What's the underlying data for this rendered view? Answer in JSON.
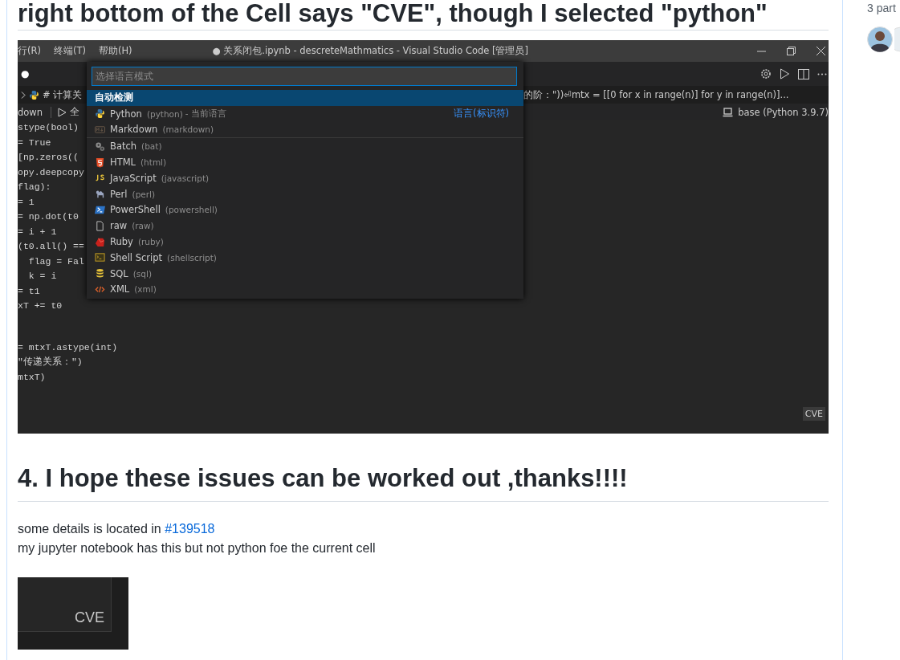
{
  "heading_top": "right bottom of the Cell says \"CVE\", though I selected \"python\"",
  "vscode_screenshot": {
    "menu": [
      "行(R)",
      "终端(T)",
      "帮助(H)"
    ],
    "title": "● 关系闭包.ipynb - descreteMathmatics - Visual Studio Code [管理员]",
    "tab_marker": "●",
    "breadcrumb_left": "# 计算关",
    "breadcrumb_right": "的阶：\"))⏎mtx = [[0 for x in range(n)] for y in range(n)]...",
    "toolbar": [
      "down",
      "全"
    ],
    "kernel": "base (Python 3.9.7)",
    "code_blocks": [
      [
        "stype(bool)",
        "= True",
        "[np.zeros((",
        "opy.deepcopy",
        "flag):",
        "= 1",
        "= np.dot(t0",
        "= i + 1",
        "(t0.all() ==",
        "  flag = Fal",
        "  k = i",
        "= t1",
        "xT += t0"
      ],
      [
        "= mtxT.astype(int)",
        "\"传递关系：\")",
        "mtxT)"
      ]
    ],
    "picker": {
      "placeholder": "选择语言模式",
      "items": [
        {
          "kind": "auto",
          "name": "自动检测",
          "selected": true
        },
        {
          "kind": "python",
          "name": "Python",
          "id": "(python)",
          "note": "- 当前语言",
          "hint": "语言(标识符)",
          "selected": false
        },
        {
          "kind": "markdown",
          "name": "Markdown",
          "id": "(markdown)",
          "selected": false
        },
        {
          "kind": "batch",
          "name": "Batch",
          "id": "(bat)",
          "selected": false
        },
        {
          "kind": "html",
          "name": "HTML",
          "id": "(html)",
          "selected": false
        },
        {
          "kind": "javascript",
          "name": "JavaScript",
          "id": "(javascript)",
          "selected": false
        },
        {
          "kind": "perl",
          "name": "Perl",
          "id": "(perl)",
          "selected": false
        },
        {
          "kind": "powershell",
          "name": "PowerShell",
          "id": "(powershell)",
          "selected": false
        },
        {
          "kind": "raw",
          "name": "raw",
          "id": "(raw)",
          "selected": false
        },
        {
          "kind": "ruby",
          "name": "Ruby",
          "id": "(ruby)",
          "selected": false
        },
        {
          "kind": "shell",
          "name": "Shell Script",
          "id": "(shellscript)",
          "selected": false
        },
        {
          "kind": "sql",
          "name": "SQL",
          "id": "(sql)",
          "selected": false
        },
        {
          "kind": "xml",
          "name": "XML",
          "id": "(xml)",
          "selected": false
        }
      ]
    },
    "cell_language": "CVE"
  },
  "heading": "4. I hope these issues can be worked out ,thanks!!!!",
  "paragraph_1": {
    "text": "some details is located in",
    "link": "#139518"
  },
  "paragraph_2": "my jupyter notebook has this but not python foe the current cell",
  "thumbnail": {
    "cell_language": "CVE"
  },
  "sidebar": {
    "participants_label": "3 part"
  }
}
